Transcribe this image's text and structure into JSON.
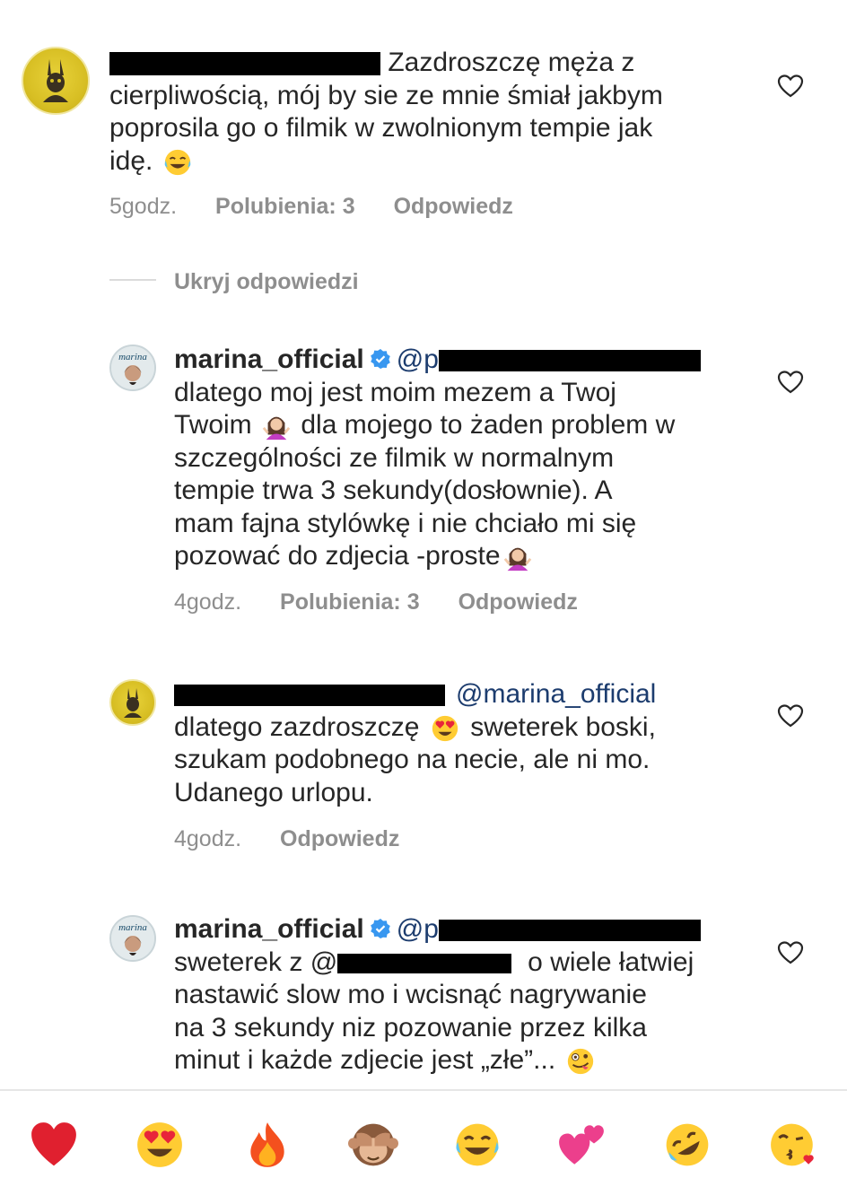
{
  "comments": [
    {
      "text_lines": [
        "Zazdroszczę męża z",
        "cierpliwością, mój by sie ze mnie śmiał jakbym",
        "poprosila go o filmik w zwolnionym tempie jak",
        "idę."
      ],
      "time": "5godz.",
      "likes": "Polubienia: 3",
      "reply": "Odpowiedz"
    },
    {
      "username": "marina_official",
      "mention_prefix": "@p",
      "text_lines": [
        "dlatego moj jest moim mezem a Twoj",
        "Twoim",
        "dla mojego to żaden problem w",
        "szczególności ze filmik w normalnym",
        "tempie trwa 3 sekundy(dosłownie). A",
        "mam fajna stylówkę i nie chciało mi się",
        "pozować do zdjecia -proste"
      ],
      "time": "4godz.",
      "likes": "Polubienia: 3",
      "reply": "Odpowiedz"
    },
    {
      "mention": "@marina_official",
      "text_lines": [
        "dlatego zazdroszczę",
        "sweterek boski,",
        "szukam podobnego na necie, ale ni mo.",
        "Udanego urlopu."
      ],
      "time": "4godz.",
      "reply": "Odpowiedz"
    },
    {
      "username": "marina_official",
      "mention_prefix": "@p",
      "text_lines": [
        "sweterek z @",
        "o wiele łatwiej",
        "nastawić slow mo i wcisnąć nagrywanie",
        "na 3 sekundy niz pozowanie przez kilka",
        "minut i każde zdjecie jest „złe”..."
      ]
    }
  ],
  "hide_replies": "Ukryj odpowiedzi",
  "avatar_marina_text": "marina",
  "emoji_bar": [
    "red-heart",
    "heart-eyes",
    "fire",
    "see-no-evil-monkey",
    "tears-of-joy",
    "two-hearts",
    "rofl",
    "kissing-heart"
  ],
  "colors": {
    "text": "#262626",
    "meta": "#8e8e8e",
    "mention": "#1c3c6e",
    "verified": "#3897f0"
  }
}
